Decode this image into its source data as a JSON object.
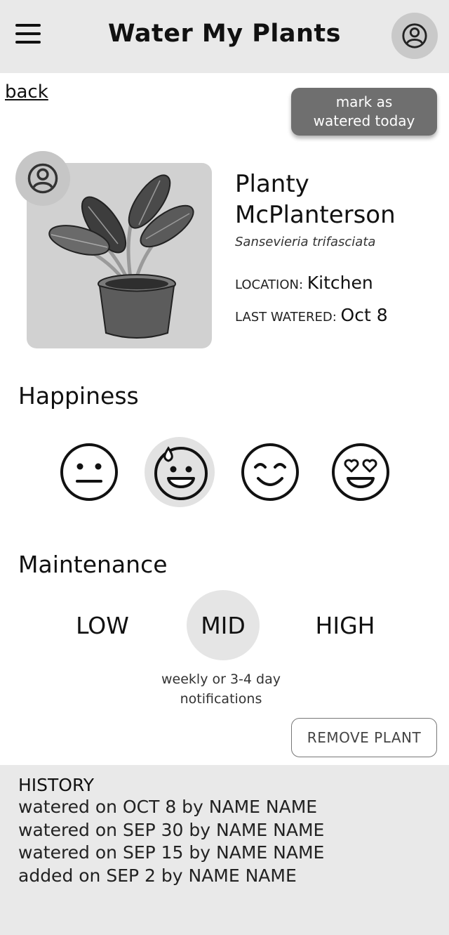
{
  "header": {
    "title": "Water My Plants",
    "menu_icon": "hamburger-menu-icon",
    "profile_icon": "user-circle-icon"
  },
  "nav": {
    "back_label": "back"
  },
  "actions": {
    "mark_watered_line1": "mark as",
    "mark_watered_line2": "watered today",
    "remove_label": "REMOVE PLANT"
  },
  "plant": {
    "name_line1": "Planty",
    "name_line2": "McPlanterson",
    "species": "Sansevieria trifasciata",
    "location_label": "LOCATION:",
    "location_value": "Kitchen",
    "last_watered_label": "LAST WATERED:",
    "last_watered_value": "Oct 8"
  },
  "happiness": {
    "title": "Happiness",
    "options": [
      "neutral-face",
      "sweat-smile-face",
      "smiling-face",
      "heart-eyes-face"
    ],
    "selected": "sweat-smile-face"
  },
  "maintenance": {
    "title": "Maintenance",
    "options": [
      "LOW",
      "MID",
      "HIGH"
    ],
    "selected": "MID",
    "note_line1": "weekly or 3-4 day",
    "note_line2": "notifications"
  },
  "history": {
    "title": "HISTORY",
    "items": [
      "watered on OCT 8 by NAME NAME",
      "watered on SEP 30 by NAME NAME",
      "watered on SEP 15 by NAME NAME",
      "added on SEP 2 by NAME NAME"
    ]
  }
}
